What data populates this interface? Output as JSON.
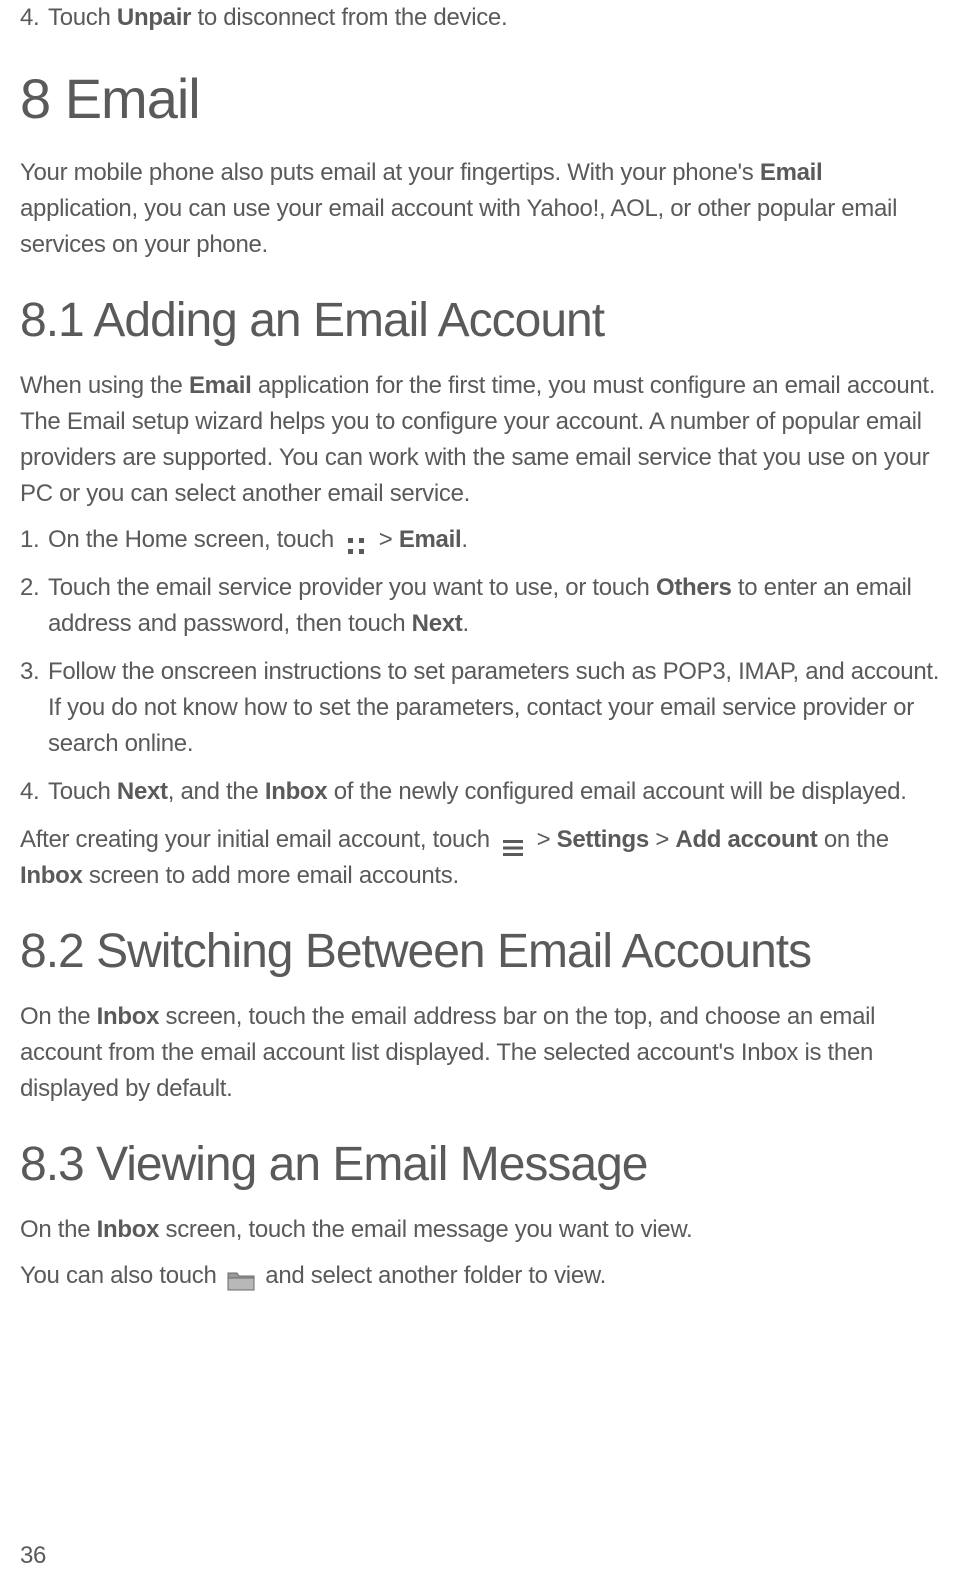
{
  "top_step": {
    "num": "4.",
    "prefix": "Touch ",
    "bold": "Unpair",
    "suffix": " to disconnect from the device."
  },
  "chapter": {
    "heading": "8  Email",
    "intro_prefix": "Your mobile phone also puts email at your fingertips. With your phone's ",
    "intro_bold": "Email",
    "intro_suffix": " application, you can use your email account with Yahoo!, AOL, or other popular email services on your phone."
  },
  "section_8_1": {
    "heading": "8.1  Adding an Email Account",
    "intro_prefix": "When using the ",
    "intro_bold": "Email",
    "intro_suffix": " application for the first time, you must configure an email account. The Email setup wizard helps you to configure your account. A number of popular email providers are supported. You can work with the same email service that you use on your PC or you can select another email service.",
    "step1": {
      "num": "1.",
      "prefix": "On the Home screen, touch ",
      "mid": " > ",
      "bold": "Email",
      "suffix": "."
    },
    "step2": {
      "num": "2.",
      "prefix": "Touch the email service provider you want to use, or touch ",
      "bold1": "Others",
      "mid": " to enter an email address and password, then touch ",
      "bold2": "Next",
      "suffix": "."
    },
    "step3": {
      "num": "3.",
      "text": "Follow the onscreen instructions to set parameters such as POP3, IMAP, and account. If you do not know how to set the parameters, contact your email service provider or search online."
    },
    "step4": {
      "num": "4.",
      "prefix": "Touch ",
      "bold1": "Next",
      "mid1": ", and the ",
      "bold2": "Inbox",
      "suffix": " of the newly configured email account will be displayed."
    },
    "after_prefix": "After creating your initial email account, touch ",
    "after_mid1": " > ",
    "after_bold1": "Settings",
    "after_mid2": " > ",
    "after_bold2": "Add account",
    "after_mid3": " on the ",
    "after_bold3": "Inbox",
    "after_suffix": " screen to add more email accounts."
  },
  "section_8_2": {
    "heading": "8.2  Switching Between Email Accounts",
    "prefix": "On the ",
    "bold": "Inbox",
    "suffix": " screen, touch the email address bar on the top, and choose an email account from the email account list displayed. The selected account's Inbox is then displayed by default."
  },
  "section_8_3": {
    "heading": "8.3  Viewing an Email Message",
    "line1_prefix": "On the ",
    "line1_bold": "Inbox",
    "line1_suffix": " screen, touch the email message you want to view.",
    "line2_prefix": "You can also touch ",
    "line2_suffix": " and select another folder to view."
  },
  "page_number": "36"
}
